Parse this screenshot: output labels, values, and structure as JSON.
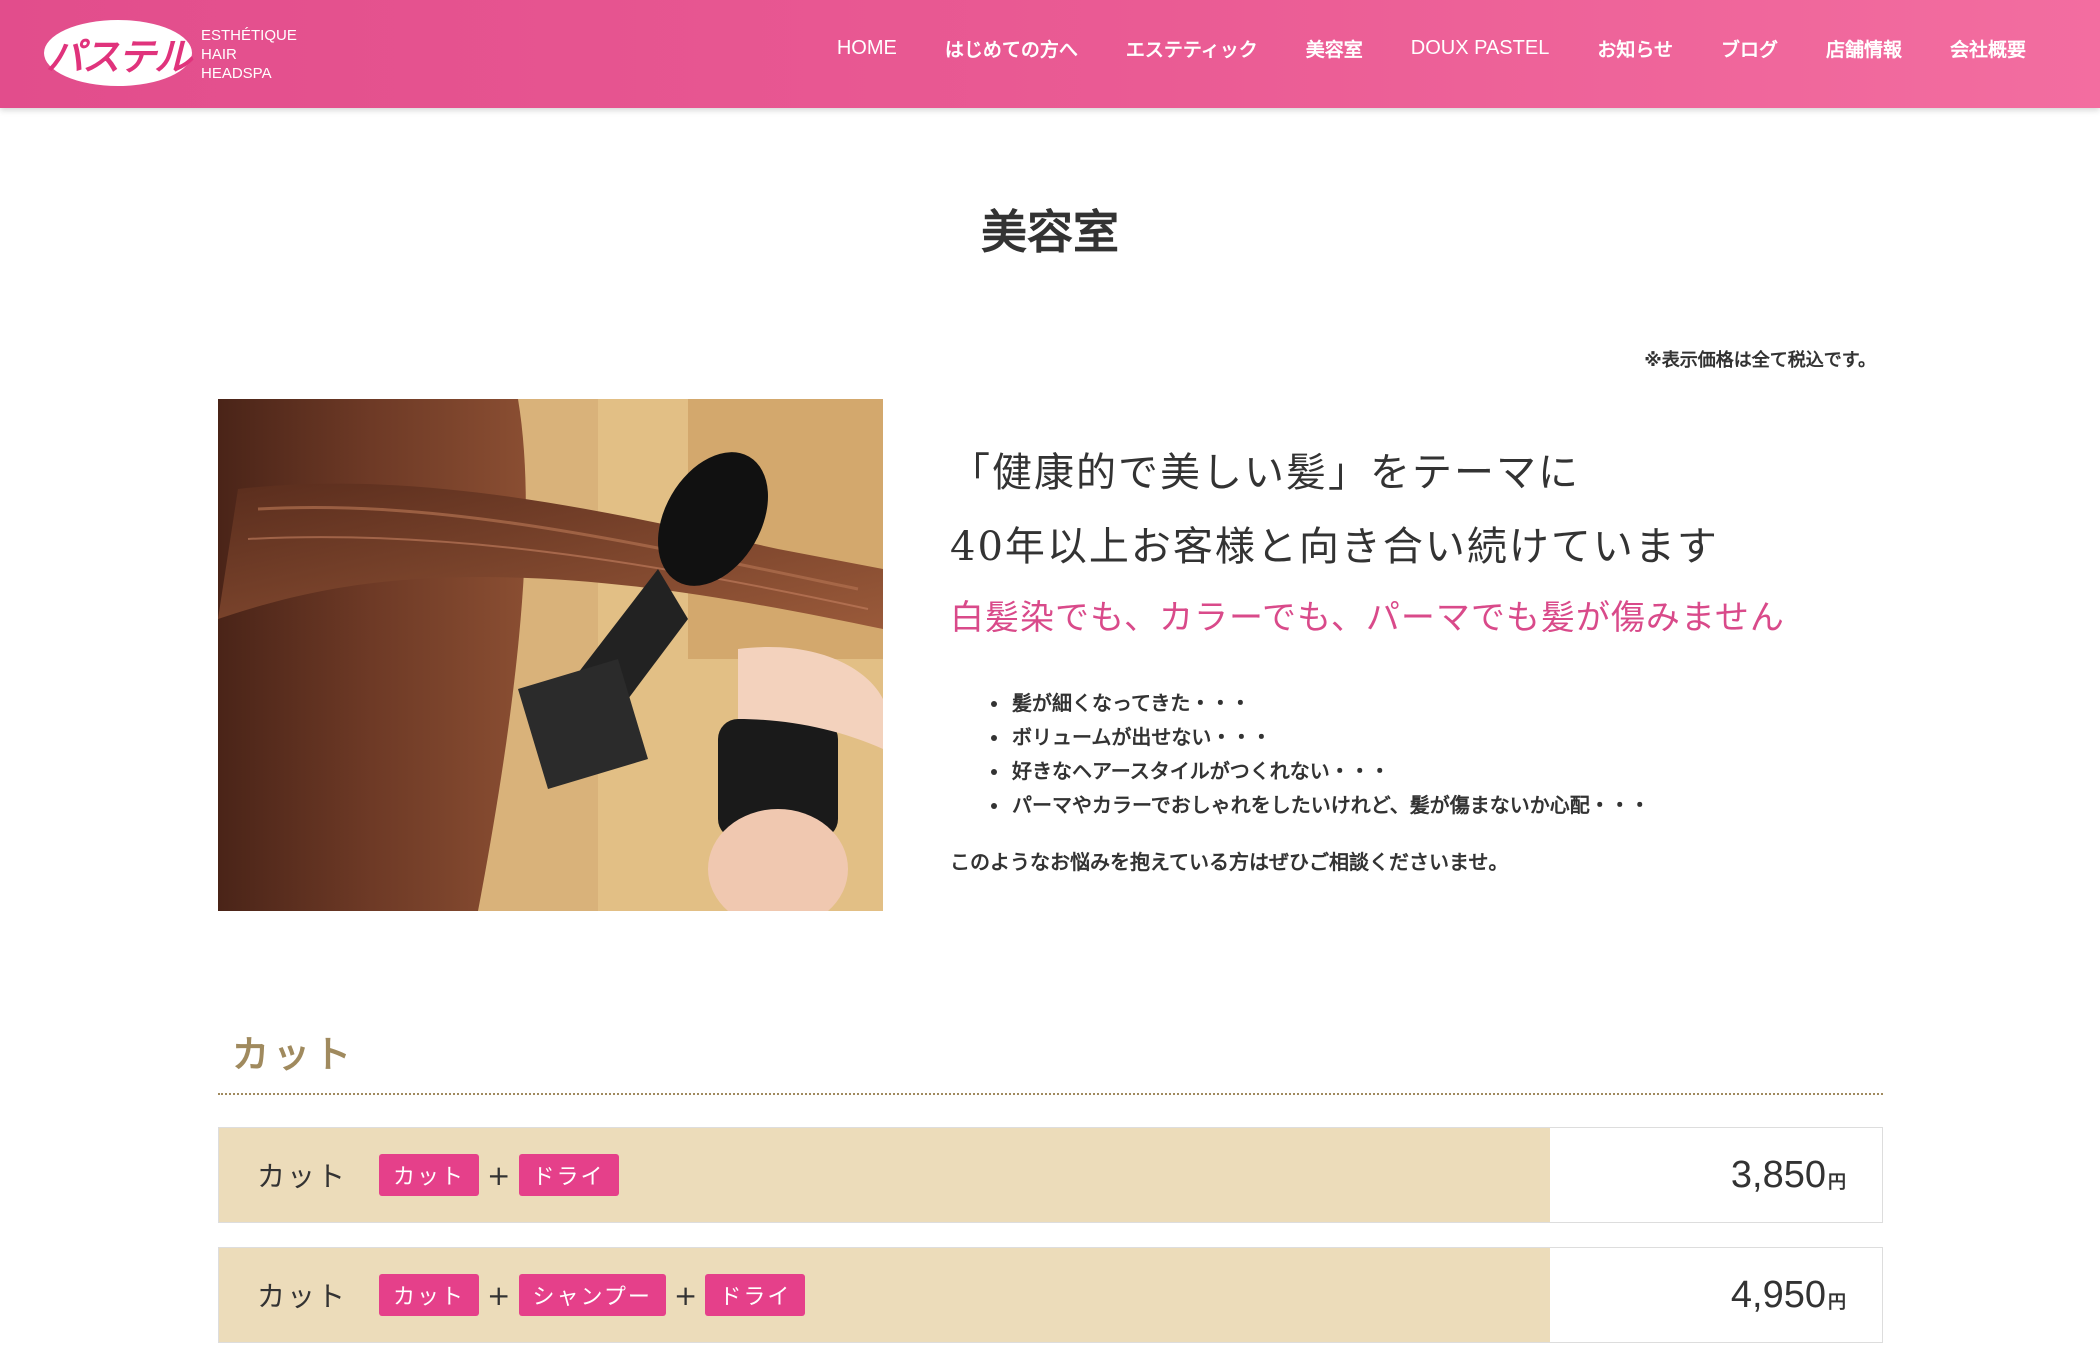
{
  "header": {
    "logo_text": "パステル",
    "tagline": [
      "ESTHÉTIQUE",
      "HAIR",
      "HEADSPA"
    ],
    "brand_color": "#e24d8c",
    "nav": [
      {
        "label": "HOME",
        "name": "nav-home"
      },
      {
        "label": "はじめての方へ",
        "name": "nav-first-time"
      },
      {
        "label": "エステティック",
        "name": "nav-esthetic"
      },
      {
        "label": "美容室",
        "name": "nav-salon"
      },
      {
        "label": "DOUX PASTEL",
        "name": "nav-doux-pastel"
      },
      {
        "label": "お知らせ",
        "name": "nav-news"
      },
      {
        "label": "ブログ",
        "name": "nav-blog"
      },
      {
        "label": "店舗情報",
        "name": "nav-store-info"
      },
      {
        "label": "会社概要",
        "name": "nav-company"
      }
    ]
  },
  "page": {
    "title": "美容室",
    "tax_note": "※表示価格は全て税込です。"
  },
  "hero": {
    "image_icon": "hair-dryer-photo",
    "heading_line1": "「健康的で美しい髪」をテーマに",
    "heading_line2": "40年以上お客様と向き合い続けています",
    "pink_line": "白髪染でも、カラーでも、パーマでも髪が傷みません",
    "pink_color": "#d94a8a",
    "worries": [
      "髪が細くなってきた・・・",
      "ボリュームが出せない・・・",
      "好きなヘアースタイルがつくれない・・・",
      "パーマやカラーでおしゃれをしたいけれど、髪が傷まないか心配・・・"
    ],
    "consult": "このようなお悩みを抱えている方はぜひご相談くださいませ。"
  },
  "section": {
    "title": "カット",
    "accent_color": "#a08a5e"
  },
  "prices": [
    {
      "name": "カット",
      "tags": [
        "カット",
        "ドライ"
      ],
      "plus": "+",
      "price": "3,850",
      "unit": "円"
    },
    {
      "name": "カット",
      "tags": [
        "カット",
        "シャンプー",
        "ドライ"
      ],
      "plus": "+",
      "price": "4,950",
      "unit": "円"
    }
  ],
  "colors": {
    "tag_bg": "#e5408a",
    "row_label_bg": "#ecdcba"
  }
}
